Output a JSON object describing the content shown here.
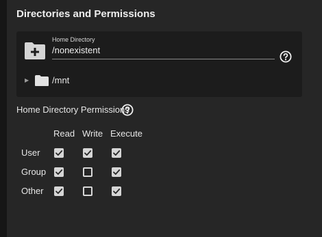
{
  "section": {
    "title": "Directories and Permissions"
  },
  "home_directory": {
    "label": "Home Directory",
    "value": "/nonexistent"
  },
  "tree": {
    "items": [
      {
        "label": "/mnt",
        "expanded": false
      }
    ]
  },
  "permissions": {
    "title": "Home Directory Permissions",
    "columns": [
      "Read",
      "Write",
      "Execute"
    ],
    "rows": [
      {
        "label": "User",
        "read": true,
        "write": true,
        "execute": true
      },
      {
        "label": "Group",
        "read": true,
        "write": false,
        "execute": true
      },
      {
        "label": "Other",
        "read": true,
        "write": false,
        "execute": true
      }
    ]
  },
  "icons": {
    "folder_add": "folder-add-icon",
    "folder": "folder-icon",
    "help": "help-circle-icon",
    "expand": "triangle-right-icon"
  }
}
